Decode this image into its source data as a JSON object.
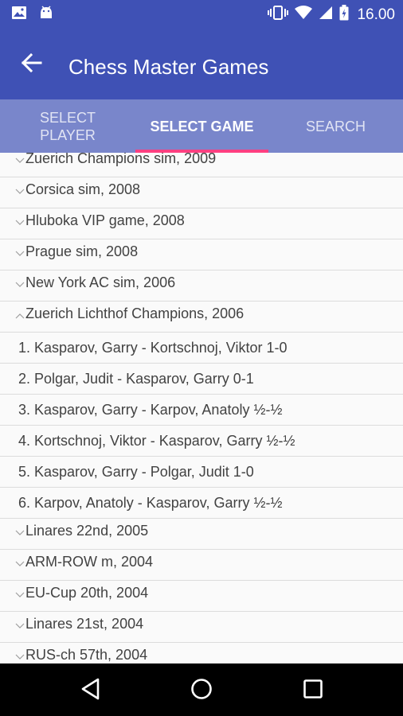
{
  "status_bar": {
    "time": "16.00",
    "icons": [
      "image-icon",
      "android-icon",
      "vibrate-icon",
      "wifi-icon",
      "cell-signal-icon",
      "battery-icon"
    ]
  },
  "app_bar": {
    "title": "Chess Master Games",
    "back_icon": "arrow-back-icon"
  },
  "tabs": [
    {
      "label": "SELECT\nPLAYER",
      "active": false
    },
    {
      "label": "SELECT GAME",
      "active": true
    },
    {
      "label": "SEARCH",
      "active": false
    }
  ],
  "list": {
    "items": [
      {
        "type": "event",
        "label": "Zuerich Champions sim, 2009",
        "expanded": false
      },
      {
        "type": "event",
        "label": "Corsica sim, 2008",
        "expanded": false
      },
      {
        "type": "event",
        "label": "Hluboka VIP game, 2008",
        "expanded": false
      },
      {
        "type": "event",
        "label": "Prague sim, 2008",
        "expanded": false
      },
      {
        "type": "event",
        "label": "New York AC sim, 2006",
        "expanded": false
      },
      {
        "type": "event",
        "label": "Zuerich Lichthof Champions, 2006",
        "expanded": true
      },
      {
        "type": "game",
        "label": "1. Kasparov, Garry - Kortschnoj, Viktor  1-0"
      },
      {
        "type": "game",
        "label": "2. Polgar, Judit - Kasparov, Garry  0-1"
      },
      {
        "type": "game",
        "label": "3. Kasparov, Garry - Karpov, Anatoly  ½-½"
      },
      {
        "type": "game",
        "label": "4. Kortschnoj, Viktor - Kasparov, Garry  ½-½"
      },
      {
        "type": "game",
        "label": "5. Kasparov, Garry - Polgar, Judit  1-0"
      },
      {
        "type": "game",
        "label": "6. Karpov, Anatoly - Kasparov, Garry  ½-½"
      },
      {
        "type": "event",
        "label": "Linares 22nd, 2005",
        "expanded": false
      },
      {
        "type": "event",
        "label": "ARM-ROW m, 2004",
        "expanded": false
      },
      {
        "type": "event",
        "label": "EU-Cup 20th, 2004",
        "expanded": false
      },
      {
        "type": "event",
        "label": "Linares 21st, 2004",
        "expanded": false
      },
      {
        "type": "event",
        "label": "RUS-ch 57th, 2004",
        "expanded": false
      }
    ]
  },
  "nav_bar": {
    "icons": [
      "back-triangle-icon",
      "home-circle-icon",
      "recents-square-icon"
    ]
  },
  "colors": {
    "primary": "#3f51b5",
    "tab_bg": "#7986cb",
    "accent": "#ff4081"
  }
}
